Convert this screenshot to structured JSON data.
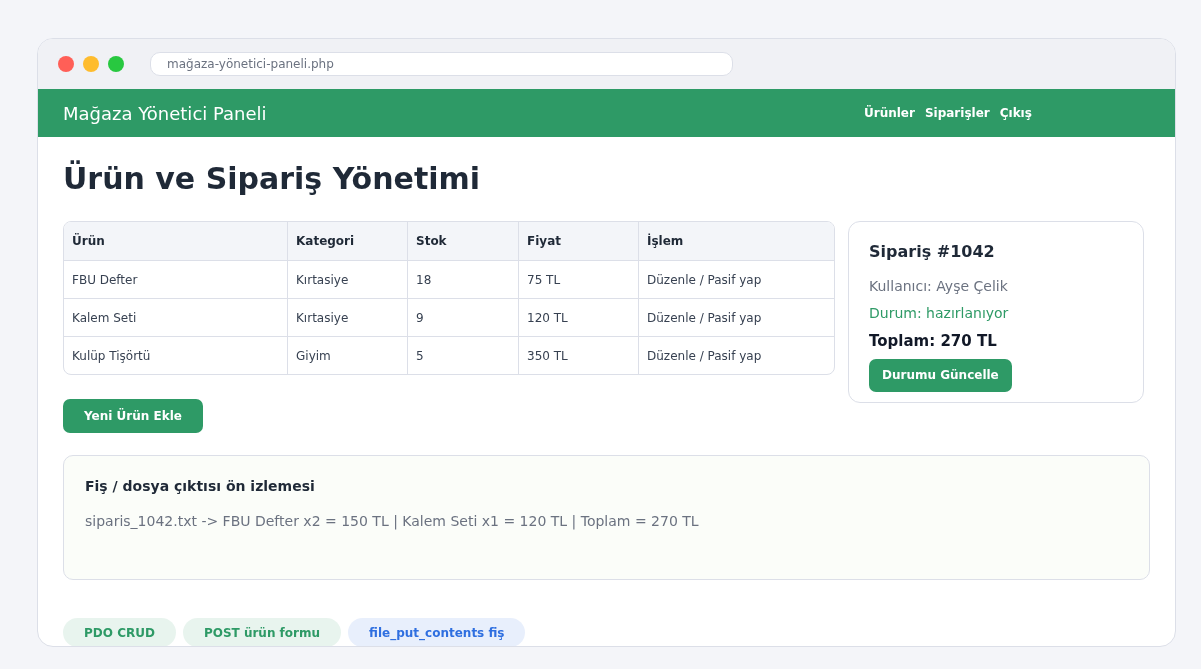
{
  "browser": {
    "address": "mağaza-yönetici-paneli.php"
  },
  "header": {
    "title": "Mağaza Yönetici Paneli",
    "nav": [
      "Ürünler",
      "Siparişler",
      "Çıkış"
    ]
  },
  "page_title": "Ürün ve Sipariş Yönetimi",
  "table": {
    "columns": [
      "Ürün",
      "Kategori",
      "Stok",
      "Fiyat",
      "İşlem"
    ],
    "rows": [
      [
        "FBU Defter",
        "Kırtasiye",
        "18",
        "75 TL",
        "Düzenle / Pasif yap"
      ],
      [
        "Kalem Seti",
        "Kırtasiye",
        "9",
        "120 TL",
        "Düzenle / Pasif yap"
      ],
      [
        "Kulüp Tişörtü",
        "Giyim",
        "5",
        "350 TL",
        "Düzenle / Pasif yap"
      ]
    ]
  },
  "add_button": "Yeni Ürün Ekle",
  "order": {
    "title": "Sipariş #1042",
    "user": "Kullanıcı: Ayşe Çelik",
    "status": "Durum: hazırlanıyor",
    "total": "Toplam: 270 TL",
    "button": "Durumu Güncelle"
  },
  "preview": {
    "title": "Fiş / dosya çıktısı ön izlemesi",
    "text": "siparis_1042.txt -> FBU Defter x2 = 150 TL | Kalem Seti x1 = 120 TL | Toplam = 270 TL"
  },
  "tags": [
    {
      "label": "PDO CRUD",
      "color": "#2e9a66"
    },
    {
      "label": "POST ürün formu",
      "color": "#2e9a66"
    },
    {
      "label": "file_put_contents fiş",
      "color": "#2f6fe0"
    }
  ]
}
